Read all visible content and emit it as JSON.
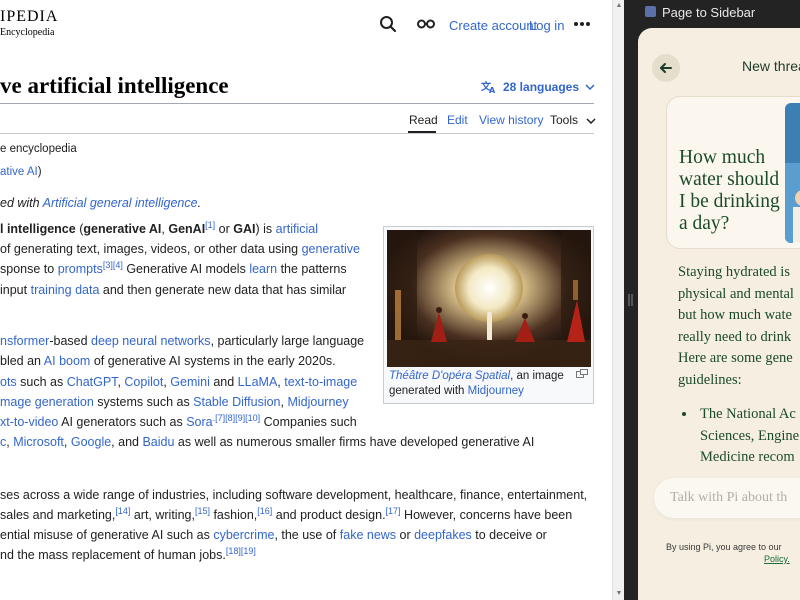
{
  "wiki": {
    "logo_word": "IPEDIA",
    "logo_sub": "Encyclopedia",
    "header": {
      "create_account": "Create account",
      "log_in": "Log in"
    },
    "title": "ve artificial intelligence",
    "languages": "28 languages",
    "tabs": {
      "read": "Read",
      "edit": "Edit",
      "view_history": "View history",
      "tools": "Tools"
    },
    "subtitle": "e encyclopedia",
    "redirect_link": "ative AI",
    "redirect_close": ")",
    "hatnote_prefix": "ed with ",
    "hatnote_link": "Artificial general intelligence",
    "hatnote_suffix": ".",
    "p1": {
      "l1_bold1": "l intelligence",
      "l1_t1": " (",
      "l1_bold2": "generative AI",
      "l1_t2": ", ",
      "l1_bold3": "GenAI",
      "l1_sup1": "[1]",
      "l1_t3": " or ",
      "l1_bold4": "GAI",
      "l1_t4": ") is ",
      "l1_link": "artificial",
      "l2_t1": "of generating text, images, videos, or other data using ",
      "l2_link": "generative",
      "l3_t1": "sponse to ",
      "l3_link": "prompts",
      "l3_sup": "[3][4]",
      "l3_t2": " Generative AI models ",
      "l3_link2": "learn",
      "l3_t3": " the patterns",
      "l4_t1": " input ",
      "l4_link": "training data",
      "l4_t2": " and then generate new data that has similar"
    },
    "p2": {
      "l1_link1": "nsformer",
      "l1_t1": "-based ",
      "l1_link2": "deep neural networks",
      "l1_t2": ", particularly large language",
      "l2_t1": "bled an ",
      "l2_link": "AI boom",
      "l2_t2": " of generative AI systems in the early 2020s.",
      "l3_link1": "ots",
      "l3_t1": " such as ",
      "l3_link2": "ChatGPT",
      "l3_t2": ", ",
      "l3_link3": "Copilot",
      "l3_t3": ", ",
      "l3_link4": "Gemini",
      "l3_t4": " and ",
      "l3_link5": "LLaMA",
      "l3_t5": ", ",
      "l3_link6": "text-to-image",
      "l4_link1": "mage generation",
      "l4_t1": " systems such as ",
      "l4_link2": "Stable Diffusion",
      "l4_t2": ", ",
      "l4_link3": "Midjourney",
      "l5_link1": "xt-to-video",
      "l5_t1": " AI generators such as ",
      "l5_link2": "Sora",
      "l5_sup": ".[7][8][9][10]",
      "l5_t2": " Companies such",
      "l6_link1": "c",
      "l6_t1": ", ",
      "l6_link2": "Microsoft",
      "l6_t2": ", ",
      "l6_link3": "Google",
      "l6_t3": ", and ",
      "l6_link4": "Baidu",
      "l6_t4": " as well as numerous smaller firms have developed generative AI"
    },
    "p3": {
      "l1": "ses across a wide range of industries, including software development, healthcare, finance, entertainment,",
      "l2_t1": " sales and marketing,",
      "l2_sup1": "[14]",
      "l2_t2": " art, writing,",
      "l2_sup2": "[15]",
      "l2_t3": " fashion,",
      "l2_sup3": "[16]",
      "l2_t4": " and product design.",
      "l2_sup4": "[17]",
      "l2_t5": " However, concerns have been",
      "l3_t1": "ential misuse of generative AI such as ",
      "l3_link1": "cybercrime",
      "l3_t2": ", the use of ",
      "l3_link2": "fake news",
      "l3_t3": " or ",
      "l3_link3": "deepfakes",
      "l3_t4": " to deceive or",
      "l4_t1": "nd the mass replacement of human jobs.",
      "l4_sup": "[18][19]"
    },
    "figure": {
      "caption_link": "Théâtre D'opéra Spatial",
      "caption_t1": ", an image",
      "caption_t2": "generated with ",
      "caption_link2": "Midjourney"
    }
  },
  "sidebar": {
    "header_title": "Page to Sidebar",
    "thread_label": "New threa",
    "question": "How much water should I be drinking a day?",
    "answer_lines": [
      "Staying hydrated is",
      "physical and mental",
      "but how much wate",
      "really need to drink",
      "Here are some gene",
      "guidelines:"
    ],
    "bullet_lines": [
      "The National Ac",
      "Sciences, Engine",
      "Medicine recom"
    ],
    "input_placeholder": "Talk with Pi about th",
    "disclaimer": "By using Pi, you agree to our",
    "policy": "Policy."
  },
  "colors": {
    "link": "#3366cc",
    "pi_background": "#f5eee1",
    "pi_text": "#1b4a2c"
  }
}
